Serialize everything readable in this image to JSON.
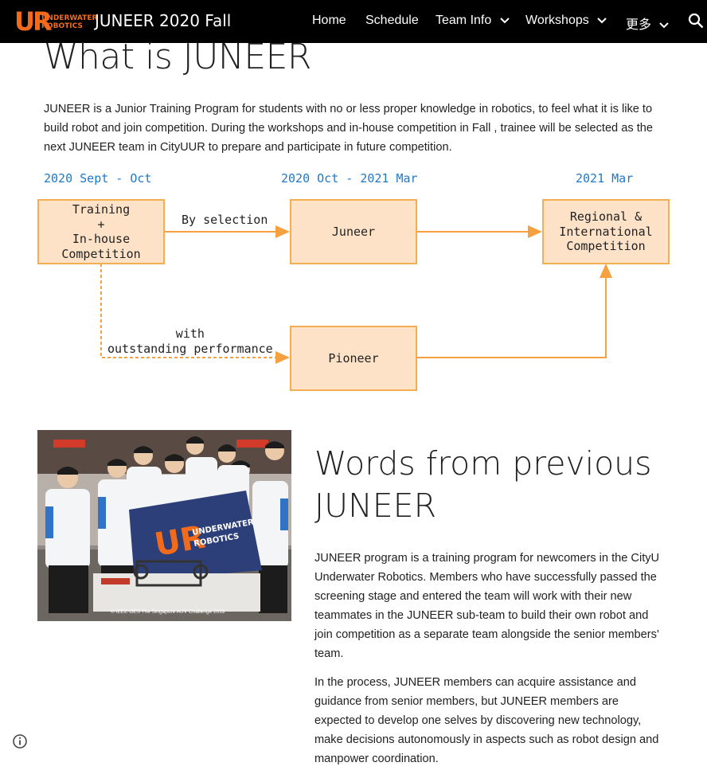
{
  "header": {
    "logo_letters": "UR",
    "logo_line1": "UNDERWATER",
    "logo_line2": "ROBOTICS",
    "site_title": "JUNEER 2020 Fall",
    "nav": [
      {
        "label": "Home"
      },
      {
        "label": "Schedule"
      },
      {
        "label": "Team Info"
      },
      {
        "label": "Workshops"
      },
      {
        "label": "更多"
      }
    ]
  },
  "section1": {
    "title": "What is JUNEER",
    "paragraph_lines": [
      "JUNEER is a Junior Training Program for students with no or less proper knowledge in robotics, to feel what it is like to",
      "build robot and join competition. During the workshops and in-house competition in Fall , trainee will be selected as the",
      "next JUNEER team in CityUUR to prepare and participate in future competition."
    ]
  },
  "diagram": {
    "periods": [
      "2020 Sept - Oct",
      "2020 Oct - 2021 Mar",
      "2021 Mar"
    ],
    "boxes": {
      "training": [
        "Training",
        "+",
        "In-house",
        "Competition"
      ],
      "juneer": "Juneer",
      "regional": [
        "Regional &",
        "International",
        "Competition"
      ],
      "pioneer": "Pioneer"
    },
    "edge_selection": "By selection",
    "edge_performance": [
      "with",
      "outstanding performance"
    ],
    "colors": {
      "box_fill": "#fde2c8",
      "box_border": "#f4ae52",
      "arrow": "#f7a040",
      "period_text": "#1f78c8"
    }
  },
  "photo": {
    "caption": "© IEEE OES The Singapore AUV Challenge 2019",
    "flag_line1": "UNDERWATER",
    "flag_line2": "ROBOTICS"
  },
  "section2": {
    "title": "Words from previous JUNEER",
    "paragraphs": [
      "JUNEER program is a training program for newcomers in the CityU Underwater Robotics. Members who have successfully passed the screening stage and entered the team will work with their new teammates in the JUNEER sub-team to build their own robot and join competition as a separate team alongside the senior members' team.",
      "In the process, JUNEER members can acquire assistance and guidance from senior members, but JUNEER members are expected to develop one selves by discovering new technology, make decisions autonomously in aspects such as robot design and manpower coordination."
    ]
  },
  "icons": {
    "search": "search-icon",
    "info": "info-icon",
    "chevron": "chevron-down-icon"
  }
}
